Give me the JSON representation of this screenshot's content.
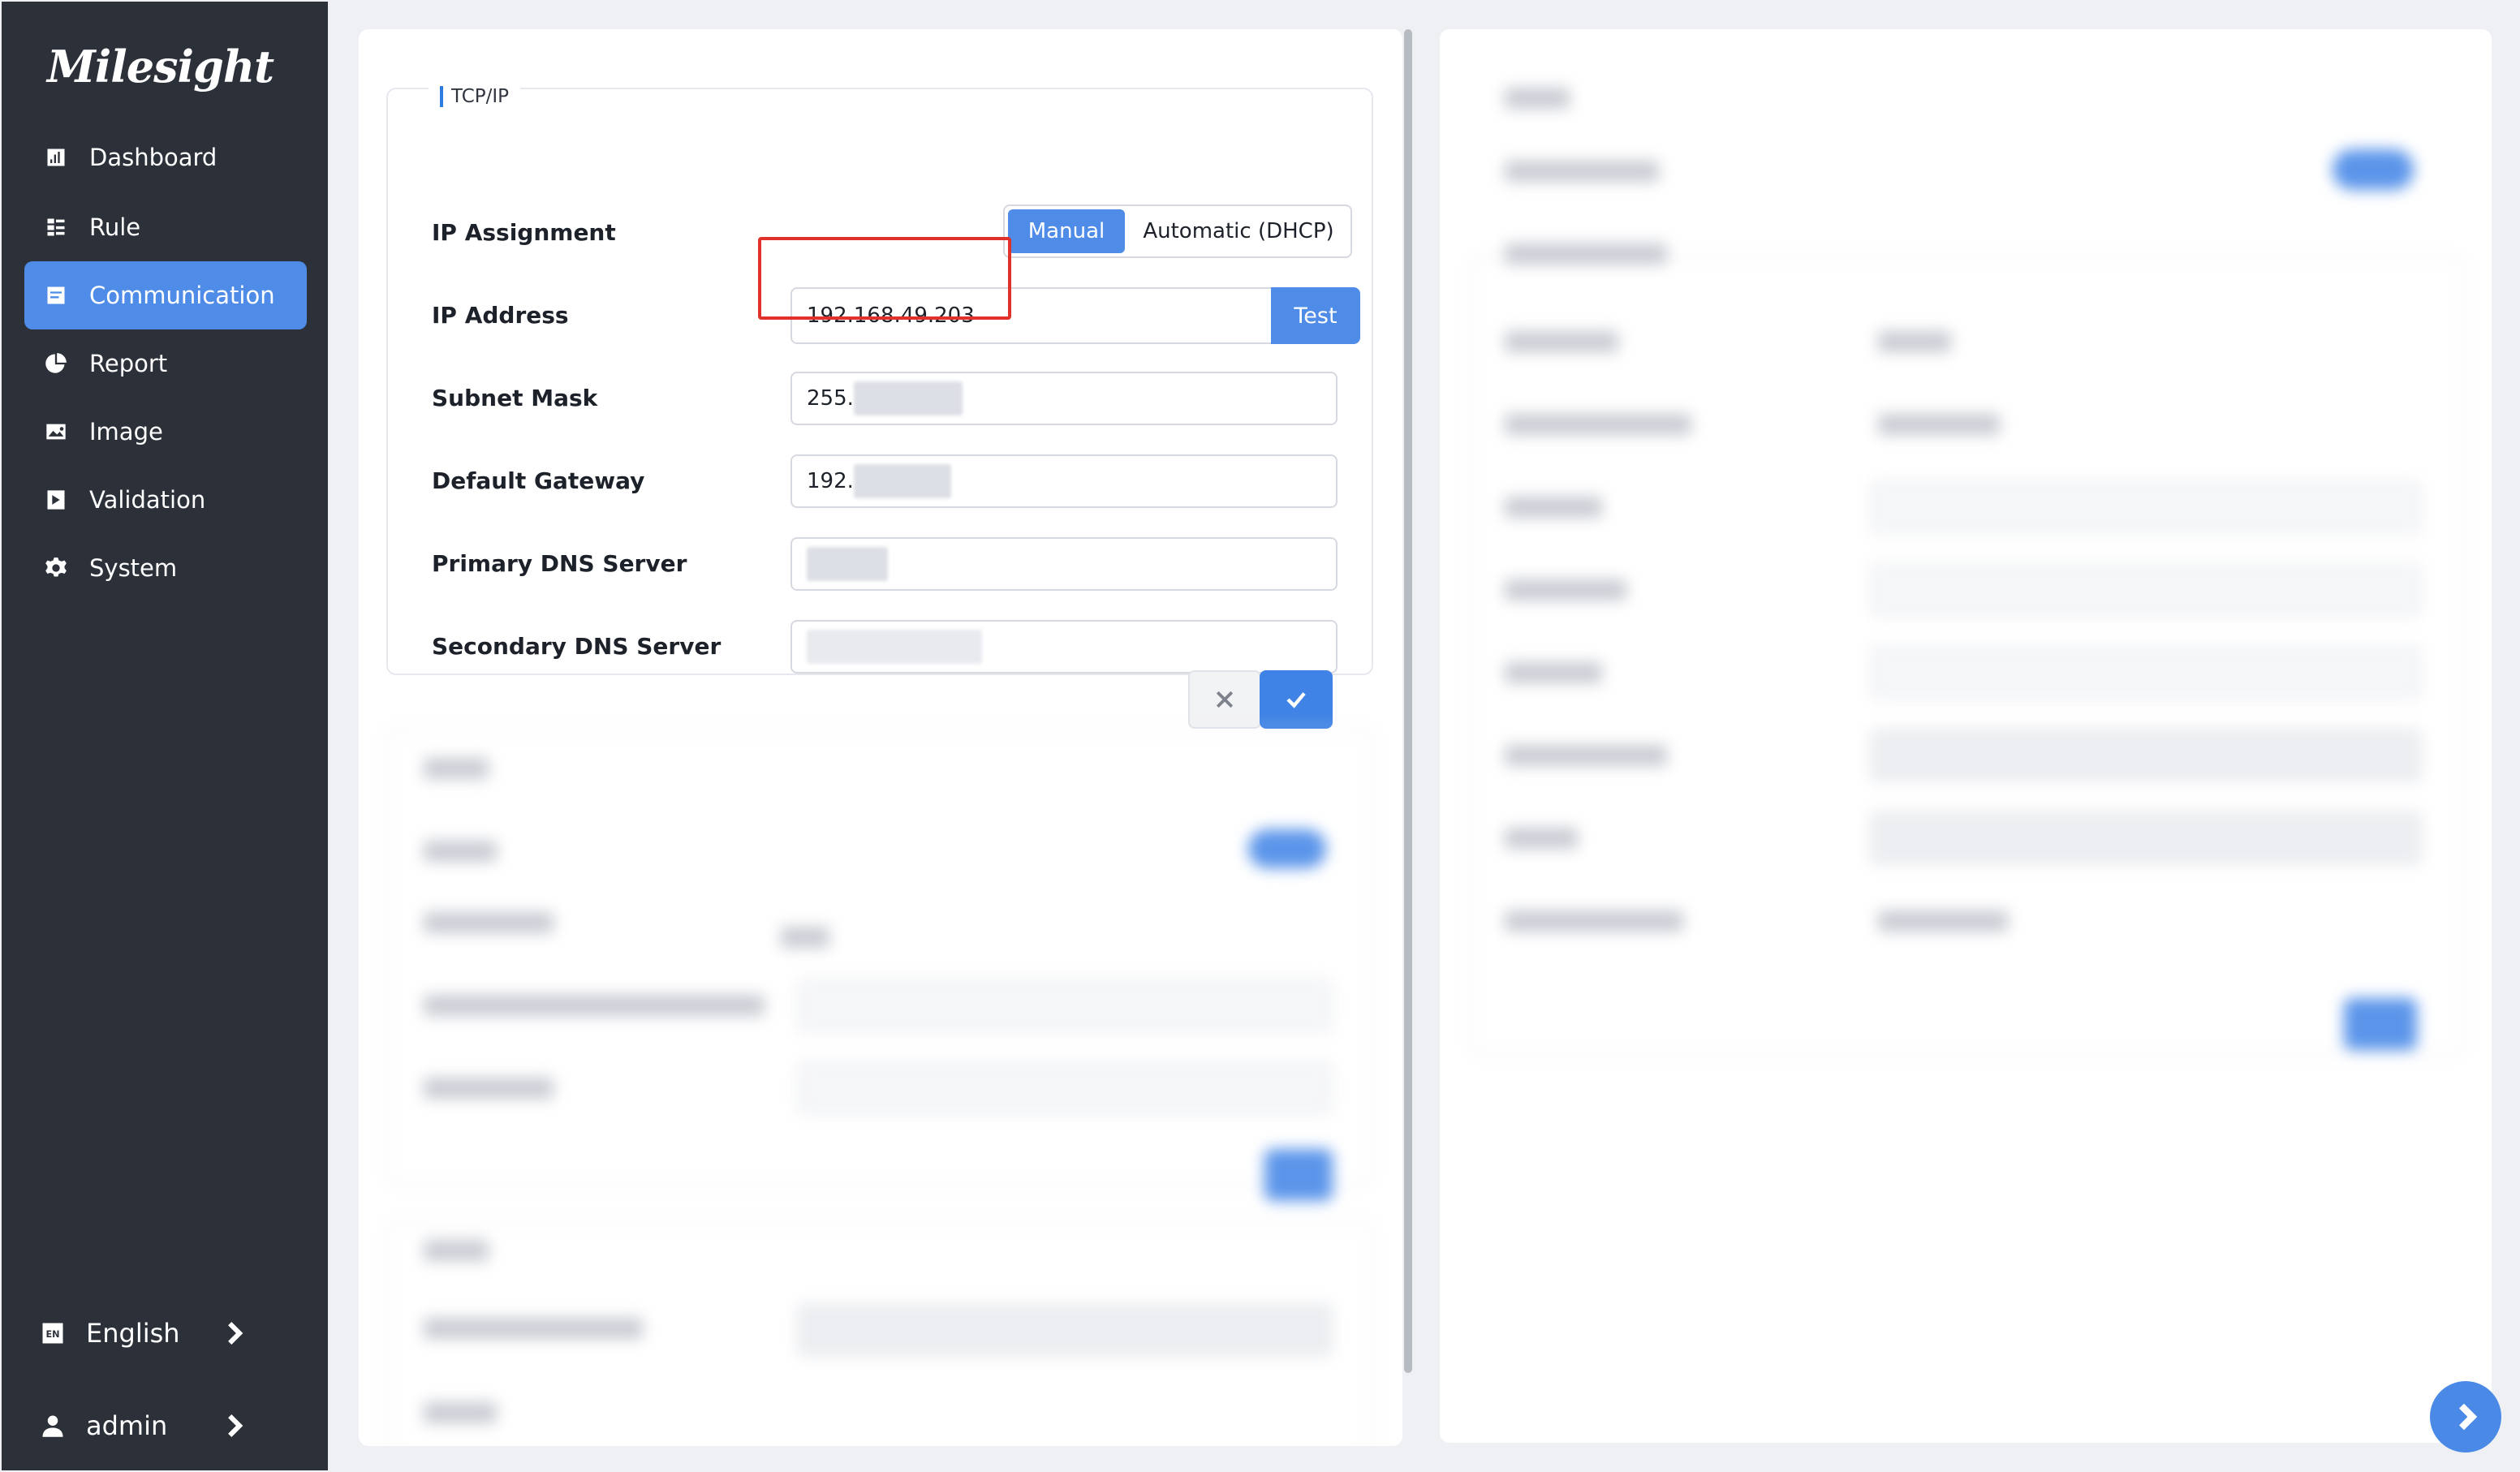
{
  "app": {
    "logo": "Milesight"
  },
  "sidebar": {
    "items": [
      {
        "label": "Dashboard",
        "icon": "bar-chart-icon",
        "active": false
      },
      {
        "label": "Rule",
        "icon": "list-icon",
        "active": false
      },
      {
        "label": "Communication",
        "icon": "communication-icon",
        "active": true
      },
      {
        "label": "Report",
        "icon": "pie-chart-icon",
        "active": false
      },
      {
        "label": "Image",
        "icon": "image-icon",
        "active": false
      },
      {
        "label": "Validation",
        "icon": "validation-icon",
        "active": false
      },
      {
        "label": "System",
        "icon": "gear-icon",
        "active": false
      }
    ],
    "language": {
      "label": "English",
      "icon": "language-icon"
    },
    "user": {
      "label": "admin",
      "icon": "user-icon"
    }
  },
  "tcpip": {
    "title": "TCP/IP",
    "ip_assignment": {
      "label": "IP Assignment",
      "options": [
        "Manual",
        "Automatic (DHCP)"
      ],
      "selected": "Manual"
    },
    "ip_address": {
      "label": "IP Address",
      "value": "192.168.49.203",
      "test_label": "Test"
    },
    "subnet_mask": {
      "label": "Subnet Mask",
      "value": "255."
    },
    "default_gateway": {
      "label": "Default Gateway",
      "value": "192."
    },
    "primary_dns": {
      "label": "Primary DNS Server",
      "value": ""
    },
    "secondary_dns": {
      "label": "Secondary DNS Server",
      "value": ""
    }
  },
  "colors": {
    "accent": "#4f8ce8",
    "sidebar_bg": "#2b3039",
    "highlight": "#e0322b"
  }
}
